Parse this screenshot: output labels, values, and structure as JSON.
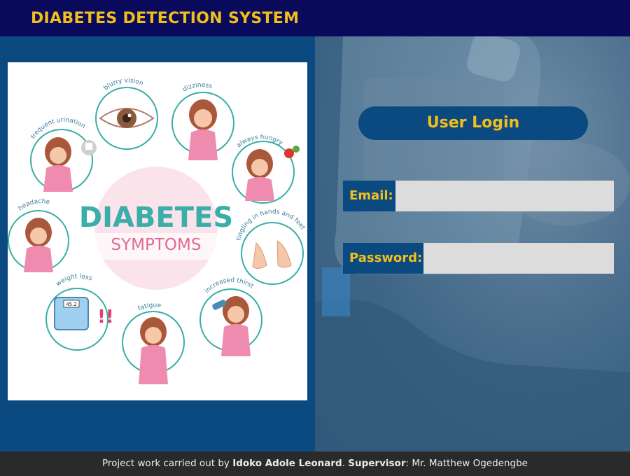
{
  "header": {
    "title": "DIABETES DETECTION SYSTEM"
  },
  "infographic": {
    "title_line1": "DIABETES",
    "title_line2": "SYMPTOMS",
    "symptoms": {
      "blurry_vision": "blurry vision",
      "dizziness": "dizziness",
      "always_hungry": "always hungry",
      "frequent_urination": "frequent urination",
      "headache": "headache",
      "tingling": "tingling in hands and feet",
      "weight_loss": "weight loss",
      "fatigue": "fatigue",
      "increased_thirst": "increased thirst"
    },
    "scale_reading": "45.2"
  },
  "login": {
    "title": "User Login",
    "email_label": "Email:",
    "email_value": "",
    "password_label": "Password:",
    "password_value": ""
  },
  "footer": {
    "prefix": "Project work carried out by ",
    "author": "Idoko Adole Leonard",
    "sep": ". ",
    "supervisor_label": "Supervisor",
    "supervisor_rest": ": Mr. Matthew Ogedengbe"
  },
  "colors": {
    "navy": "#0a0a5c",
    "blue": "#0b4a80",
    "gold": "#f2bf1a",
    "teal": "#3aaea8",
    "pink": "#e06a95"
  }
}
